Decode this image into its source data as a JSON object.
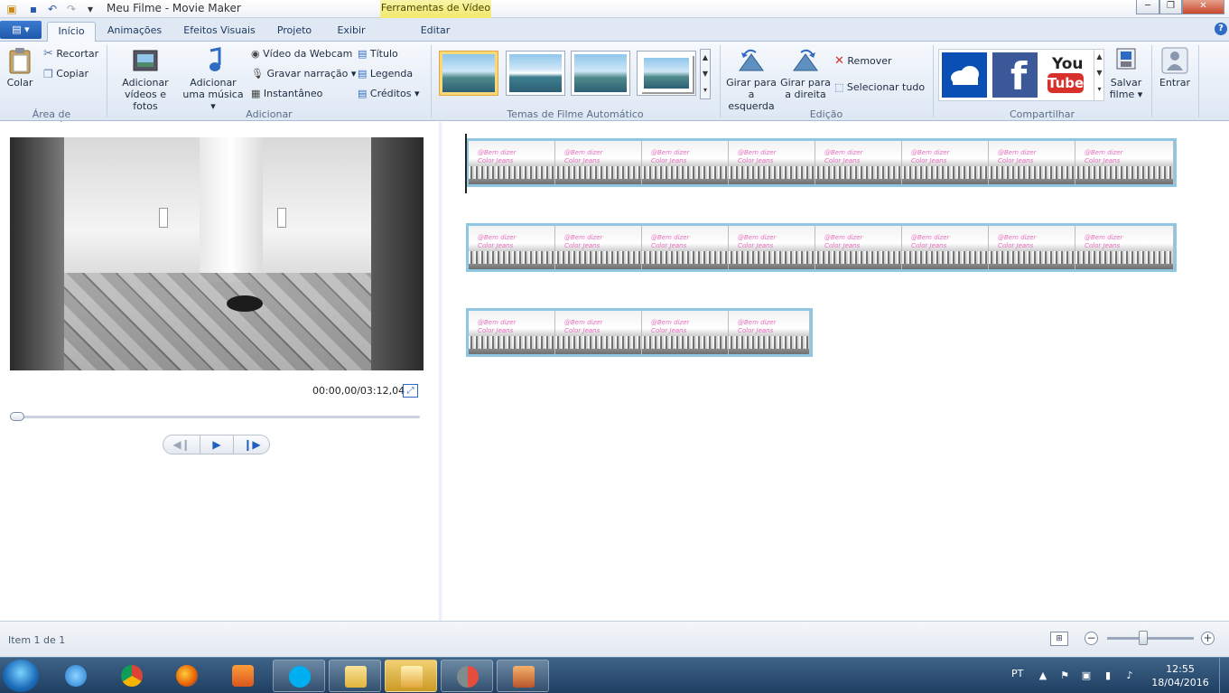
{
  "window": {
    "title": "Meu Filme - Movie Maker",
    "contextual_tab": "Ferramentas de Vídeo",
    "controls": [
      "─",
      "❐",
      "✕"
    ]
  },
  "tabs": {
    "app_menu": "▤ ▾",
    "items": [
      "Início",
      "Animações",
      "Efeitos Visuais",
      "Projeto",
      "Exibir",
      "Editar"
    ],
    "active": "Início",
    "help": "?"
  },
  "ribbon": {
    "clipboard": {
      "label": "Área de Transferência",
      "paste": "Colar",
      "cut": "Recortar",
      "copy": "Copiar"
    },
    "add": {
      "label": "Adicionar",
      "add_videos": [
        "Adicionar",
        "vídeos e fotos"
      ],
      "add_music": [
        "Adicionar",
        "uma música ▾"
      ],
      "webcam": "Vídeo da Webcam",
      "narration": "Gravar narração ▾",
      "snapshot": "Instantâneo",
      "title": "Título",
      "caption": "Legenda",
      "credits": "Créditos ▾"
    },
    "themes": {
      "label": "Temas de Filme Automático"
    },
    "editing": {
      "label": "Edição",
      "rotate_left": [
        "Girar para",
        "a esquerda"
      ],
      "rotate_right": [
        "Girar para",
        "a direita"
      ],
      "remove": "Remover",
      "select_all": "Selecionar tudo"
    },
    "share": {
      "label": "Compartilhar",
      "youtube_you": "You",
      "youtube_tube": "Tube",
      "facebook": "f",
      "save_movie": [
        "Salvar",
        "filme ▾"
      ]
    },
    "signin": {
      "label": "Entrar"
    }
  },
  "preview": {
    "timecode": "00:00,00/03:12,04",
    "progress": 0
  },
  "storyboard": {
    "overlay_text": [
      "@Bem dizer",
      "Color Jeans"
    ]
  },
  "status": {
    "item_text": "Item 1 de 1",
    "zoom_level": 0.42
  },
  "taskbar": {
    "language": "PT",
    "time": "12:55",
    "date": "18/04/2016"
  }
}
